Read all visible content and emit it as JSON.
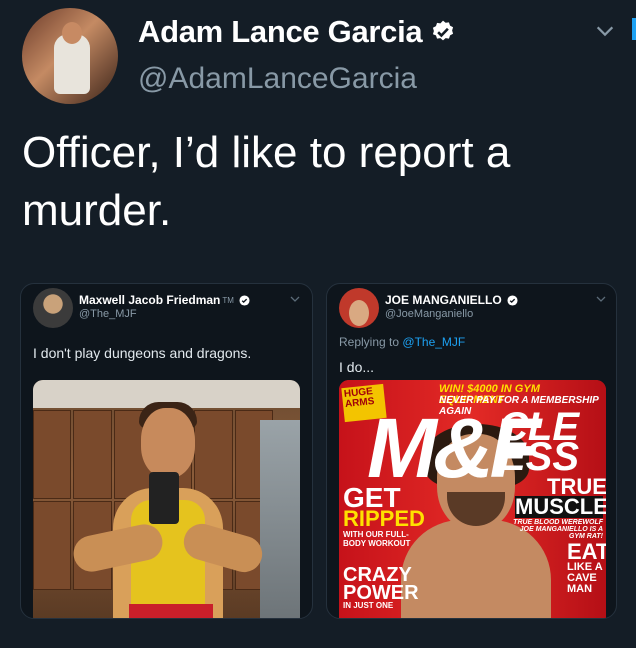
{
  "tweet": {
    "display_name": "Adam Lance Garcia",
    "handle": "@AdamLanceGarcia",
    "text": "Officer, I’d like to report a murder.",
    "verified_color": "#ffffff",
    "accent": "#1da1f2"
  },
  "embedded": [
    {
      "display_name": "Maxwell Jacob Friedman",
      "tm": "TM",
      "handle": "@The_MJF",
      "text": "I don't play dungeons and dragons."
    },
    {
      "display_name": "JOE MANGANIELLO",
      "handle": "@JoeManganiello",
      "reply_prefix": "Replying to",
      "reply_to": "@The_MJF",
      "text": "I do...",
      "magazine": {
        "huge": "HUGE ARMS",
        "win": "WIN! $4000 IN GYM EQUIPMENT",
        "never": "NEVER PAY FOR A MEMBERSHIP AGAIN",
        "logo": "M&F",
        "cle": "CLE",
        "ess": "ESS",
        "get": "GET",
        "ripped": "RIPPED",
        "withour": "WITH OUR FULL-BODY WORKOUT",
        "crazy": "CRAZY",
        "power": "POWER",
        "injust": "IN JUST ONE",
        "true": "TRUE",
        "muscle": "MUSCLE",
        "blood": "TRUE BLOOD WEREWOLF JOE MANGANIELLO IS A GYM RAT!",
        "eat": "EAT",
        "likea": "LIKE A CAVE MAN"
      }
    }
  ]
}
